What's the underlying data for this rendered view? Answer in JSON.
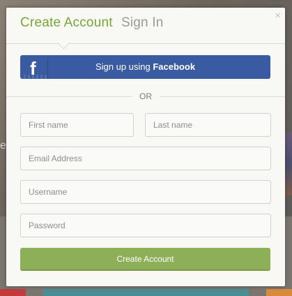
{
  "tabs": {
    "create": "Create Account",
    "signin": "Sign In"
  },
  "close_glyph": "×",
  "facebook": {
    "logo": "f",
    "prefix": "Sign up using ",
    "brand": "Facebook",
    "color": "#3b5ba0"
  },
  "divider": {
    "text": "OR"
  },
  "form": {
    "first_name": {
      "placeholder": "First name",
      "value": ""
    },
    "last_name": {
      "placeholder": "Last name",
      "value": ""
    },
    "email": {
      "placeholder": "Email Address",
      "value": ""
    },
    "username": {
      "placeholder": "Username",
      "value": ""
    },
    "password": {
      "placeholder": "Password",
      "value": ""
    },
    "submit": "Create Account"
  },
  "background": {
    "left_text": "es"
  },
  "colors": {
    "accent_green": "#7aa53a",
    "button_green": "#8caf57",
    "tab_inactive": "#9a9a96"
  }
}
